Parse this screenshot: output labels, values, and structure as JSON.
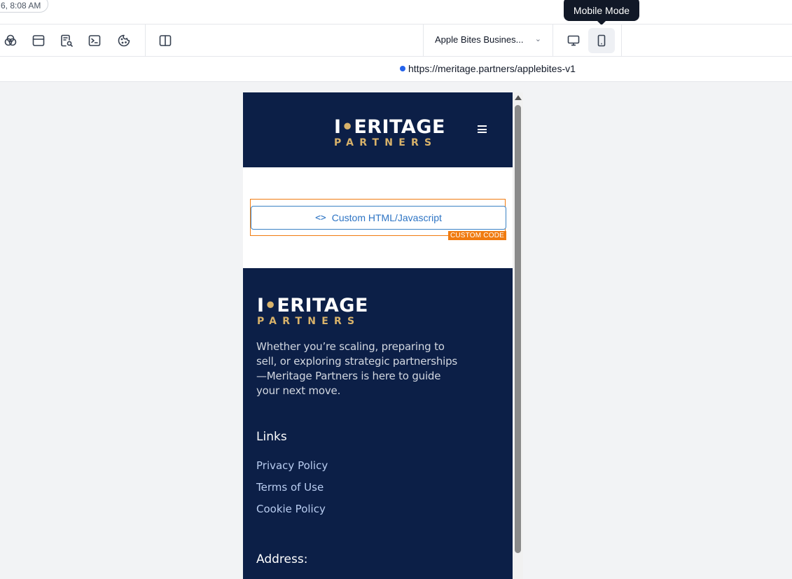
{
  "top": {
    "timestamp": "6, 8:08 AM",
    "tooltip": "Mobile Mode"
  },
  "toolbar": {
    "site_selector": "Apple Bites Busines...",
    "icons": [
      "layers-icon",
      "window-icon",
      "page-search-icon",
      "terminal-icon",
      "cookie-icon",
      "split-view-icon"
    ],
    "modes": [
      {
        "name": "desktop-mode",
        "active": false
      },
      {
        "name": "mobile-mode",
        "active": true
      }
    ]
  },
  "urlbar": {
    "url": "https://meritage.partners/applebites-v1"
  },
  "page": {
    "logo": {
      "line1_first": "I",
      "line1_rest": "ERITAGE",
      "line2": "PARTNERS"
    },
    "custom_code": {
      "button_label": "Custom HTML/Javascript",
      "code_glyph": "<>",
      "tag": "CUSTOM CODE"
    },
    "footer": {
      "tagline": "Whether you’re scaling, preparing to sell, or exploring strategic partnerships—Meritage Partners is here to guide your next move.",
      "links_heading": "Links",
      "links": [
        "Privacy Policy",
        "Terms of Use",
        "Cookie Policy"
      ],
      "address_heading": "Address:"
    }
  },
  "colors": {
    "navy": "#0c1f47",
    "gold": "#d8b26a",
    "accent_blue": "#2d74c4",
    "custom_orange": "#f07b10"
  }
}
